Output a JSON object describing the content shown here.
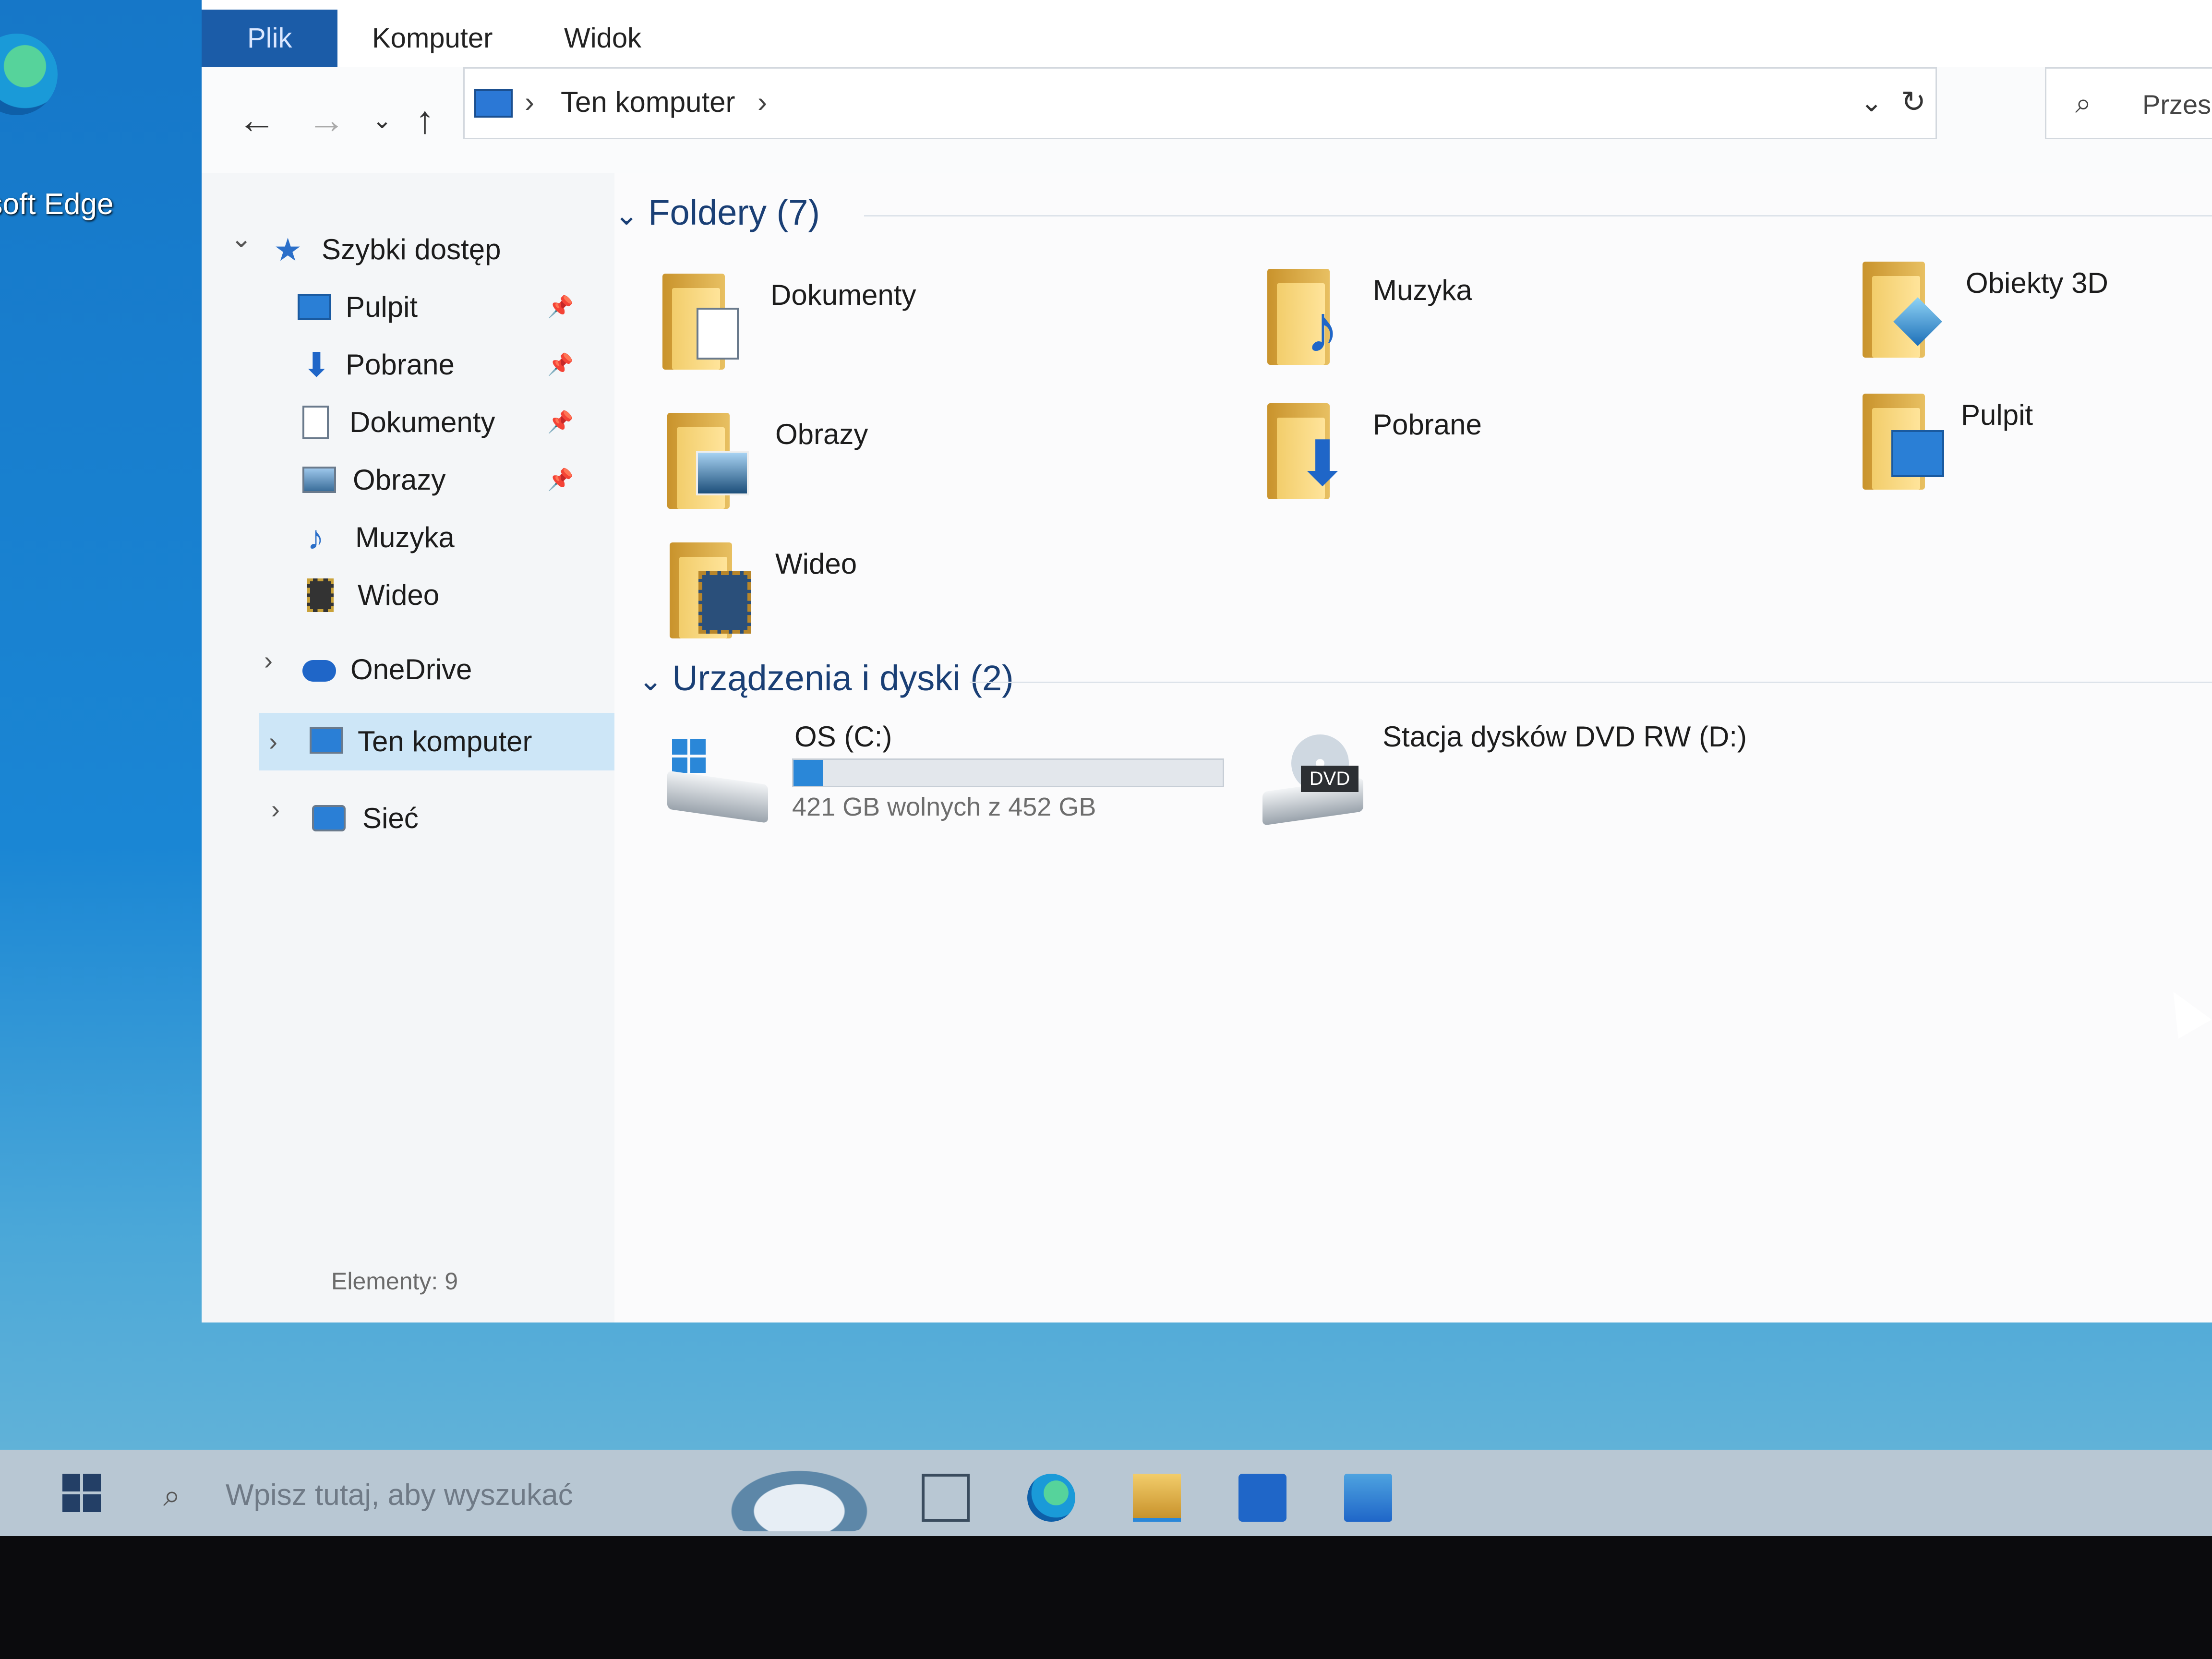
{
  "desktop": {
    "edge_label": "osoft Edge"
  },
  "ribbon": {
    "tabs": [
      "Plik",
      "Komputer",
      "Widok"
    ]
  },
  "address": {
    "separator_1": "›",
    "crumb": "Ten komputer",
    "separator_2": "›",
    "dropdown": "⌄",
    "refresh": "↻"
  },
  "search": {
    "placeholder": "Przesz"
  },
  "nav": {
    "quick_access": "Szybki dostęp",
    "pinned": [
      {
        "label": "Pulpit",
        "icon": "desktop-icon"
      },
      {
        "label": "Pobrane",
        "icon": "download-icon"
      },
      {
        "label": "Dokumenty",
        "icon": "document-icon"
      },
      {
        "label": "Obrazy",
        "icon": "pictures-icon"
      }
    ],
    "items": [
      {
        "label": "Muzyka",
        "icon": "music-icon"
      },
      {
        "label": "Wideo",
        "icon": "video-icon"
      }
    ],
    "onedrive": "OneDrive",
    "this_pc": "Ten komputer",
    "network": "Sieć"
  },
  "folders": {
    "header": "Foldery (7)",
    "items": [
      {
        "label": "Dokumenty",
        "icon": "documents-folder-icon"
      },
      {
        "label": "Muzyka",
        "icon": "music-folder-icon"
      },
      {
        "label": "Obiekty 3D",
        "icon": "3d-objects-folder-icon"
      },
      {
        "label": "Obrazy",
        "icon": "pictures-folder-icon"
      },
      {
        "label": "Pobrane",
        "icon": "downloads-folder-icon"
      },
      {
        "label": "Pulpit",
        "icon": "desktop-folder-icon"
      },
      {
        "label": "Wideo",
        "icon": "videos-folder-icon"
      }
    ]
  },
  "devices": {
    "header": "Urządzenia i dyski (2)",
    "drive_c": {
      "label": "OS (C:)",
      "free_text": "421 GB wolnych z 452 GB",
      "used_fraction": 0.069
    },
    "drive_d": {
      "label": "Stacja dysków DVD RW (D:)",
      "badge": "DVD"
    }
  },
  "status": {
    "items": "Elementy: 9"
  },
  "taskbar": {
    "search_placeholder": "Wpisz tutaj, aby wyszukać"
  },
  "colors": {
    "accent": "#2a87d8",
    "folder_header": "#1a3f75",
    "selected": "#cde6f7"
  }
}
